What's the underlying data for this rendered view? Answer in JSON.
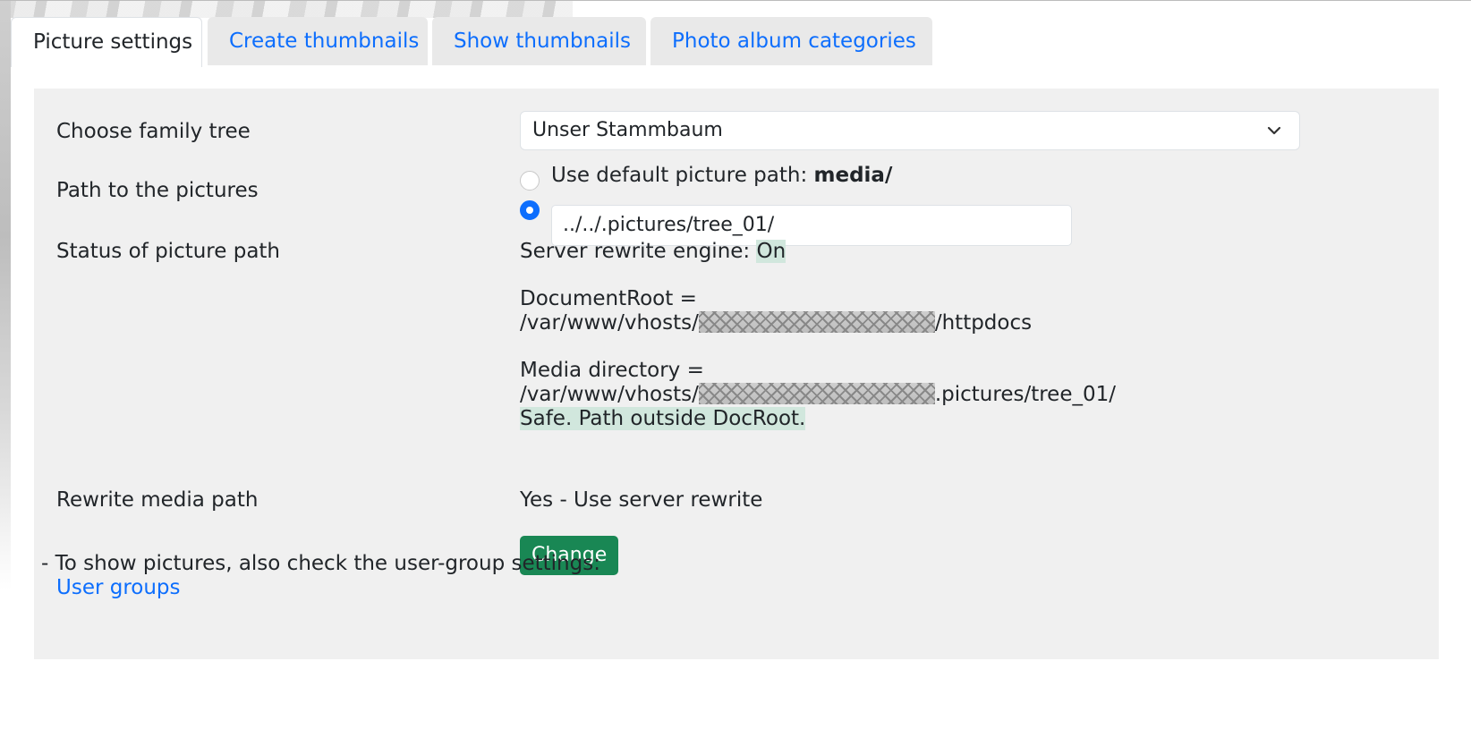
{
  "tabs": [
    {
      "label": "Picture settings",
      "active": true
    },
    {
      "label": "Create thumbnails",
      "active": false
    },
    {
      "label": "Show thumbnails",
      "active": false
    },
    {
      "label": "Photo album categories",
      "active": false
    }
  ],
  "family_tree": {
    "label": "Choose family tree",
    "selected": "Unser Stammbaum"
  },
  "picture_path": {
    "label": "Path to the pictures",
    "default_option": "Use default picture path:",
    "default_value": "media/",
    "custom_value": "../../.pictures/tree_01/",
    "selected": "custom"
  },
  "status": {
    "label": "Status of picture path",
    "rewrite_engine_label": "Server rewrite engine:",
    "rewrite_engine_value": "On",
    "docroot_label": "DocumentRoot =",
    "docroot_prefix": "/var/www/vhosts/",
    "docroot_suffix": "/httpdocs",
    "media_label": "Media directory =",
    "media_prefix": "/var/www/vhosts/",
    "media_suffix": ".pictures/tree_01/",
    "safe_message": "Safe. Path outside DocRoot."
  },
  "rewrite": {
    "label": "Rewrite media path",
    "value": "Yes - Use server rewrite",
    "button": "Change"
  },
  "note": {
    "text": "- To show pictures, also check the user-group settings:",
    "link": "User groups"
  },
  "colors": {
    "accent": "#0d6efd",
    "success_button": "#198754",
    "highlight": "#d1e7dd"
  }
}
